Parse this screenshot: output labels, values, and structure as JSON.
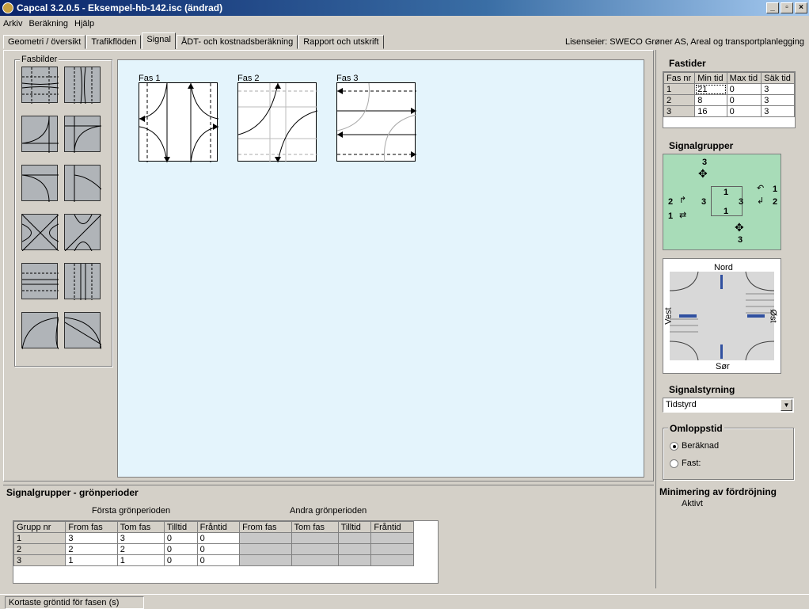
{
  "window": {
    "title": "Capcal 3.2.0.5 - Eksempel-hb-142.isc (ändrad)"
  },
  "menu": [
    "Arkiv",
    "Beräkning",
    "Hjälp"
  ],
  "tabs": [
    {
      "label": "Geometri / översikt"
    },
    {
      "label": "Trafikflöden"
    },
    {
      "label": "Signal",
      "active": true
    },
    {
      "label": "ÅDT- och kostnadsberäkning"
    },
    {
      "label": "Rapport och utskrift"
    }
  ],
  "license": "Lisenseier: SWECO Grøner AS, Areal og transportplanlegging",
  "fasbilder": {
    "label": "Fasbilder",
    "count": 12
  },
  "phases": [
    {
      "label": "Fas 1"
    },
    {
      "label": "Fas 2"
    },
    {
      "label": "Fas 3"
    }
  ],
  "fastider": {
    "title": "Fastider",
    "headers": [
      "Fas nr",
      "Min tid",
      "Max tid",
      "Säk tid"
    ],
    "rows": [
      [
        "1",
        "21",
        "0",
        "3"
      ],
      [
        "2",
        "8",
        "0",
        "3"
      ],
      [
        "3",
        "16",
        "0",
        "3"
      ]
    ]
  },
  "signalgrupper": {
    "title": "Signalgrupper",
    "labels": {
      "top": "3",
      "left_a": "2",
      "left_b": "1",
      "right_a": "1",
      "right_b": "2",
      "bottom": "3",
      "inner_top": "1",
      "inner_left": "3",
      "inner_right": "3",
      "inner_bottom": "1"
    }
  },
  "compass": {
    "north": "Nord",
    "south": "Sør",
    "west": "Vest",
    "east": "Øst"
  },
  "signalstyrning": {
    "title": "Signalstyrning",
    "value": "Tidstyrd"
  },
  "omloppstid": {
    "title": "Omloppstid",
    "options": [
      {
        "label": "Beräknad",
        "checked": true
      },
      {
        "label": "Fast:",
        "checked": false
      }
    ]
  },
  "minimering": {
    "title": "Minimering av fördröjning",
    "value": "Aktivt"
  },
  "gronperioder": {
    "title": "Signalgrupper - grönperioder",
    "first": "Första grönperioden",
    "second": "Andra grönperioden",
    "headers": [
      "Grupp nr",
      "From fas",
      "Tom fas",
      "Tilltid",
      "Fråntid",
      "From fas",
      "Tom fas",
      "Tilltid",
      "Fråntid"
    ],
    "rows": [
      [
        "1",
        "3",
        "3",
        "0",
        "0"
      ],
      [
        "2",
        "2",
        "2",
        "0",
        "0"
      ],
      [
        "3",
        "1",
        "1",
        "0",
        "0"
      ]
    ]
  },
  "status": "Kortaste gröntid för fasen (s)"
}
